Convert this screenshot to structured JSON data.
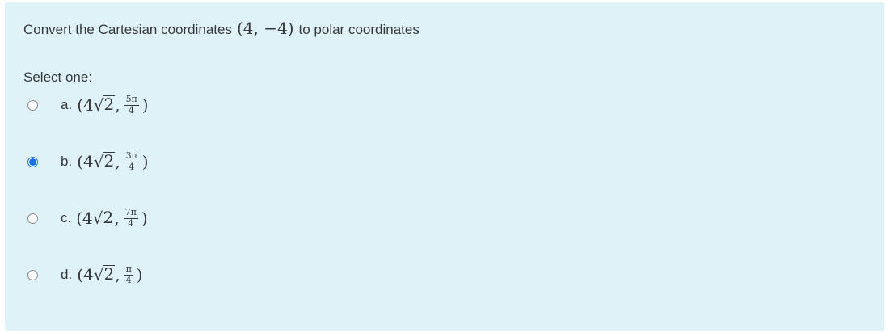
{
  "question": {
    "text_before": "Convert the Cartesian coordinates",
    "point": "(4, −4)",
    "text_after": "to polar coordinates"
  },
  "select_label": "Select one:",
  "options": [
    {
      "letter": "a.",
      "open": "(4",
      "sqrt_radicand": "2",
      "comma": ",",
      "num": "5π",
      "den": "4",
      "close": ")",
      "selected": false
    },
    {
      "letter": "b.",
      "open": "(4",
      "sqrt_radicand": "2",
      "comma": ",",
      "num": "3π",
      "den": "4",
      "close": ")",
      "selected": true
    },
    {
      "letter": "c.",
      "open": "(4",
      "sqrt_radicand": "2",
      "comma": ",",
      "num": "7π",
      "den": "4",
      "close": ")",
      "selected": false
    },
    {
      "letter": "d.",
      "open": "(4",
      "sqrt_radicand": "2",
      "comma": ",",
      "num": "π",
      "den": "4",
      "close": ")",
      "selected": false
    }
  ],
  "colors": {
    "panel_background": "#def2f8",
    "text": "#373a3c",
    "radio_selected": "#1a73e8"
  }
}
